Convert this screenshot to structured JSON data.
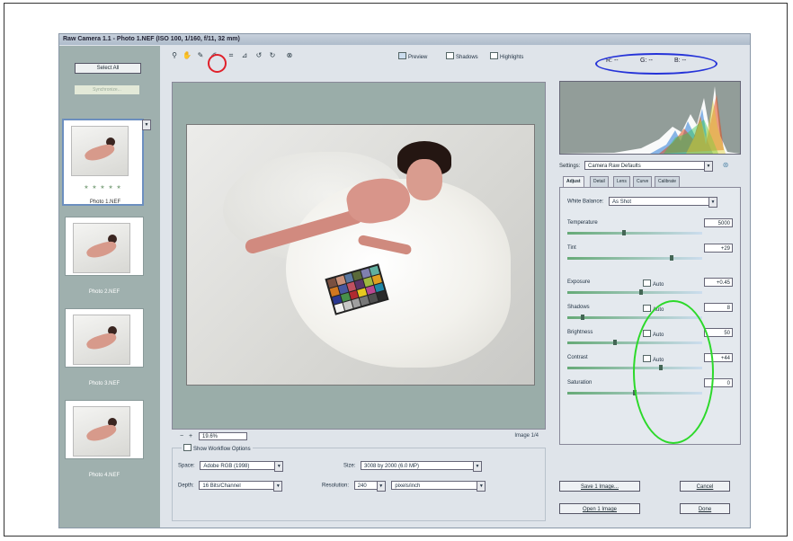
{
  "window": {
    "title": "Raw Camera 1.1 - Photo 1.NEF (ISO 100, 1/160, f/11, 32 mm)"
  },
  "filmstrip": {
    "select_all": "Select All",
    "synchronize": "Synchronize...",
    "rating": "★ ★ ★ ★ ★",
    "thumbs": [
      {
        "caption": "Photo 1.NEF"
      },
      {
        "caption": "Photo 2.NEF"
      },
      {
        "caption": "Photo 3.NEF"
      },
      {
        "caption": "Photo 4.NEF"
      }
    ]
  },
  "toolbar": {
    "tools": [
      "zoom-icon",
      "hand-icon",
      "white-balance-icon",
      "color-sampler-icon",
      "crop-icon",
      "straighten-icon",
      "rotate-left-icon",
      "rotate-right-icon",
      "delete-icon"
    ],
    "preview": "Preview",
    "shadows": "Shadows",
    "highlights": "Highlights"
  },
  "rgb": {
    "r": "R: --",
    "g": "G: --",
    "b": "B: --"
  },
  "canvas_footer": {
    "zoom": "19.6%",
    "counter": "Image 1/4"
  },
  "workflow": {
    "show_options": "Show Workflow Options",
    "space_label": "Space:",
    "space": "Adobe RGB (1998)",
    "size_label": "Size:",
    "size": "3008 by 2000 (6.0 MP)",
    "depth_label": "Depth:",
    "depth": "16 Bits/Channel",
    "resolution_label": "Resolution:",
    "resolution": "240",
    "resolution_unit": "pixels/inch"
  },
  "settings": {
    "label": "Settings:",
    "value": "Camera Raw Defaults"
  },
  "tabs": [
    "Adjust",
    "Detail",
    "Lens",
    "Curve",
    "Calibrate"
  ],
  "adjust": {
    "white_balance_label": "White Balance:",
    "white_balance": "As Shot",
    "rows": [
      {
        "label": "Temperature",
        "value": "5000",
        "auto": false,
        "knob": 0.42
      },
      {
        "label": "Tint",
        "value": "+29",
        "auto": false,
        "knob": 0.78
      },
      {
        "label": "Exposure",
        "value": "+0.45",
        "auto": true,
        "knob": 0.55
      },
      {
        "label": "Shadows",
        "value": "8",
        "auto": true,
        "knob": 0.1
      },
      {
        "label": "Brightness",
        "value": "50",
        "auto": true,
        "knob": 0.35
      },
      {
        "label": "Contrast",
        "value": "+44",
        "auto": true,
        "knob": 0.7
      },
      {
        "label": "Saturation",
        "value": "0",
        "auto": false,
        "knob": 0.5
      }
    ],
    "auto_label": "Auto"
  },
  "buttons": {
    "save": "Save 1 Image...",
    "open": "Open 1 Image",
    "cancel": "Cancel",
    "done": "Done"
  },
  "annotations": {
    "red": "#e0202a",
    "blue": "#2533d8",
    "green": "#2cd92a"
  }
}
